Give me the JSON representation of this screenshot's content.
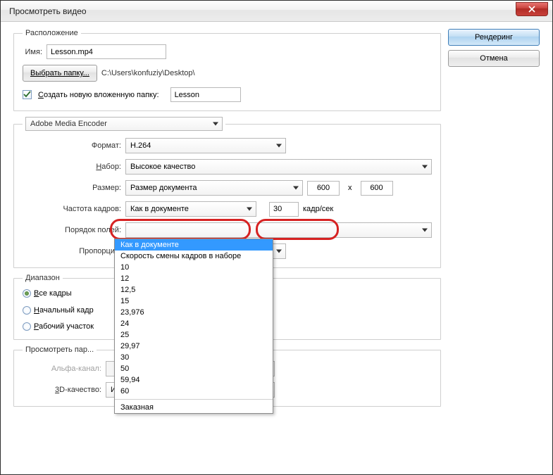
{
  "window": {
    "title": "Просмотреть видео"
  },
  "sidebar": {
    "render": "Рендеринг",
    "cancel": "Отмена"
  },
  "location": {
    "legend": "Расположение",
    "name_label": "Имя:",
    "name_value": "Lesson.mp4",
    "choose_folder": "Выбрать папку...",
    "path": "C:\\Users\\konfuziy\\Desktop\\",
    "create_subfolder_label": "Создать новую вложенную папку:",
    "subfolder_value": "Lesson"
  },
  "encoder": {
    "name": "Adobe Media Encoder",
    "format_label": "Формат:",
    "format_value": "H.264",
    "preset_label": "Набор:",
    "preset_value": "Высокое качество",
    "size_label": "Размер:",
    "size_value": "Размер документа",
    "size_w": "600",
    "size_x": "x",
    "size_h": "600",
    "framerate_label": "Частота кадров:",
    "framerate_value": "Как в документе",
    "framerate_num": "30",
    "framerate_unit": "кадр/сек",
    "framerate_options": [
      "Как в документе",
      "Скорость смены кадров в наборе",
      "10",
      "12",
      "12,5",
      "15",
      "23,976",
      "24",
      "25",
      "29,97",
      "30",
      "50",
      "59,94",
      "60",
      "Заказная"
    ],
    "field_order_label": "Порядок полей:",
    "aspect_label": "Пропорция:"
  },
  "range": {
    "legend": "Диапазон",
    "all": "Все кадры",
    "start": "Начальный кадр",
    "work": "Рабочий участок"
  },
  "preview": {
    "legend": "Просмотреть пар...",
    "alpha_label": "Альфа-канал:",
    "quality_label": "3D-качество:",
    "quality_value": "Интерактивный"
  }
}
